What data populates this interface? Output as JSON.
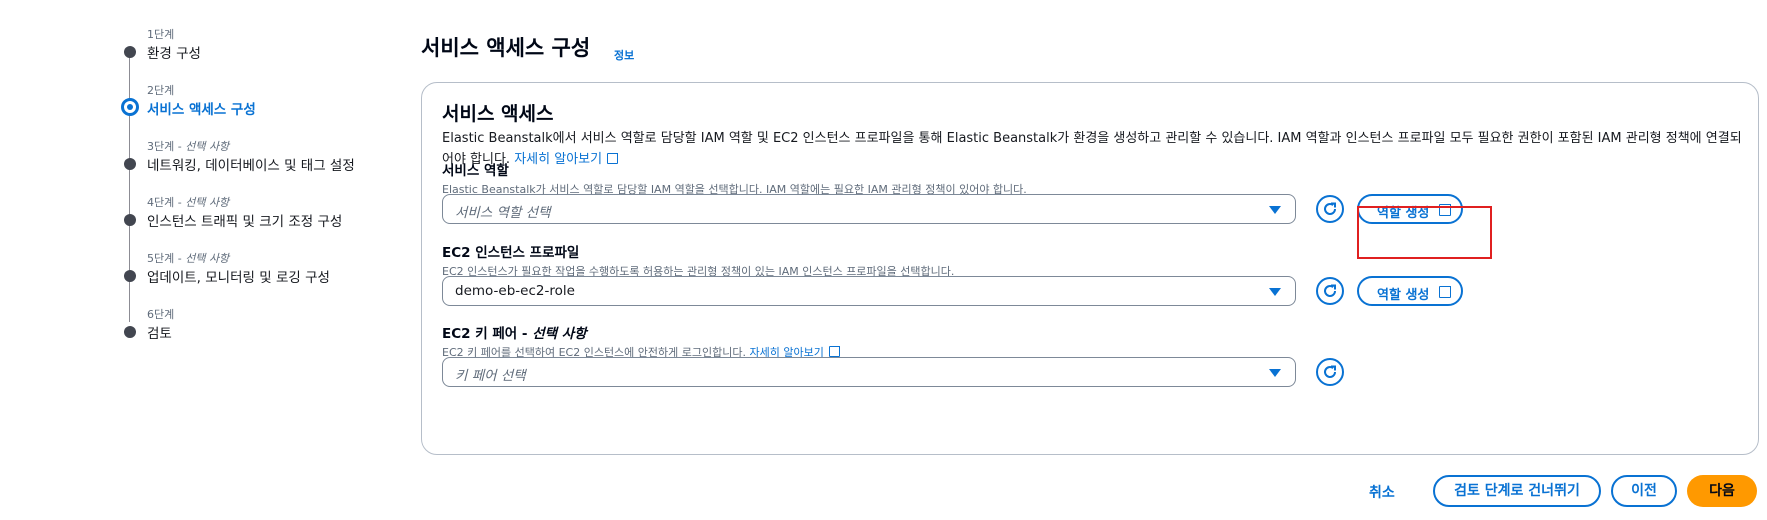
{
  "steps": [
    {
      "num": "1단계",
      "optional": "",
      "title": "환경 구성"
    },
    {
      "num": "2단계",
      "optional": "",
      "title": "서비스 액세스 구성"
    },
    {
      "num": "3단계 - ",
      "optional": "선택 사항",
      "title": "네트워킹, 데이터베이스 및 태그 설정"
    },
    {
      "num": "4단계 - ",
      "optional": "선택 사항",
      "title": "인스턴스 트래픽 및 크기 조정 구성"
    },
    {
      "num": "5단계 - ",
      "optional": "선택 사항",
      "title": "업데이트, 모니터링 및 로깅 구성"
    },
    {
      "num": "6단계",
      "optional": "",
      "title": "검토"
    }
  ],
  "active_step": 2,
  "header": {
    "title": "서비스 액세스 구성",
    "info": "정보"
  },
  "panel": {
    "title": "서비스 액세스",
    "description": "Elastic Beanstalk에서 서비스 역할로 담당할 IAM 역할 및 EC2 인스턴스 프로파일을 통해 Elastic Beanstalk가 환경을 생성하고 관리할 수 있습니다. IAM 역할과 인스턴스 프로파일 모두 필요한 권한이 포함된 IAM 관리형 정책에 연결되어야 합니다.",
    "learn_more": "자세히 알아보기"
  },
  "service_role": {
    "label": "서비스 역할",
    "hint": "Elastic Beanstalk가 서비스 역할로 담당할 IAM 역할을 선택합니다. IAM 역할에는 필요한 IAM 관리형 정책이 있어야 합니다.",
    "placeholder": "서비스 역할 선택",
    "create_label": "역할 생성"
  },
  "instance_profile": {
    "label": "EC2 인스턴스 프로파일",
    "hint": "EC2 인스턴스가 필요한 작업을 수행하도록 허용하는 관리형 정책이 있는 IAM 인스턴스 프로파일을 선택합니다.",
    "value": "demo-eb-ec2-role",
    "create_label": "역할 생성"
  },
  "key_pair": {
    "label": "EC2 키 페어 - ",
    "label_optional": "선택 사항",
    "hint": "EC2 키 페어를 선택하여 EC2 인스턴스에 안전하게 로그인합니다.",
    "learn_more": "자세히 알아보기",
    "placeholder": "키 페어 선택"
  },
  "footer": {
    "cancel": "취소",
    "skip": "검토 단계로 건너뛰기",
    "previous": "이전",
    "next": "다음"
  },
  "colors": {
    "accent": "#0972d3",
    "primary": "#ff9900",
    "highlight": "#e02020"
  }
}
